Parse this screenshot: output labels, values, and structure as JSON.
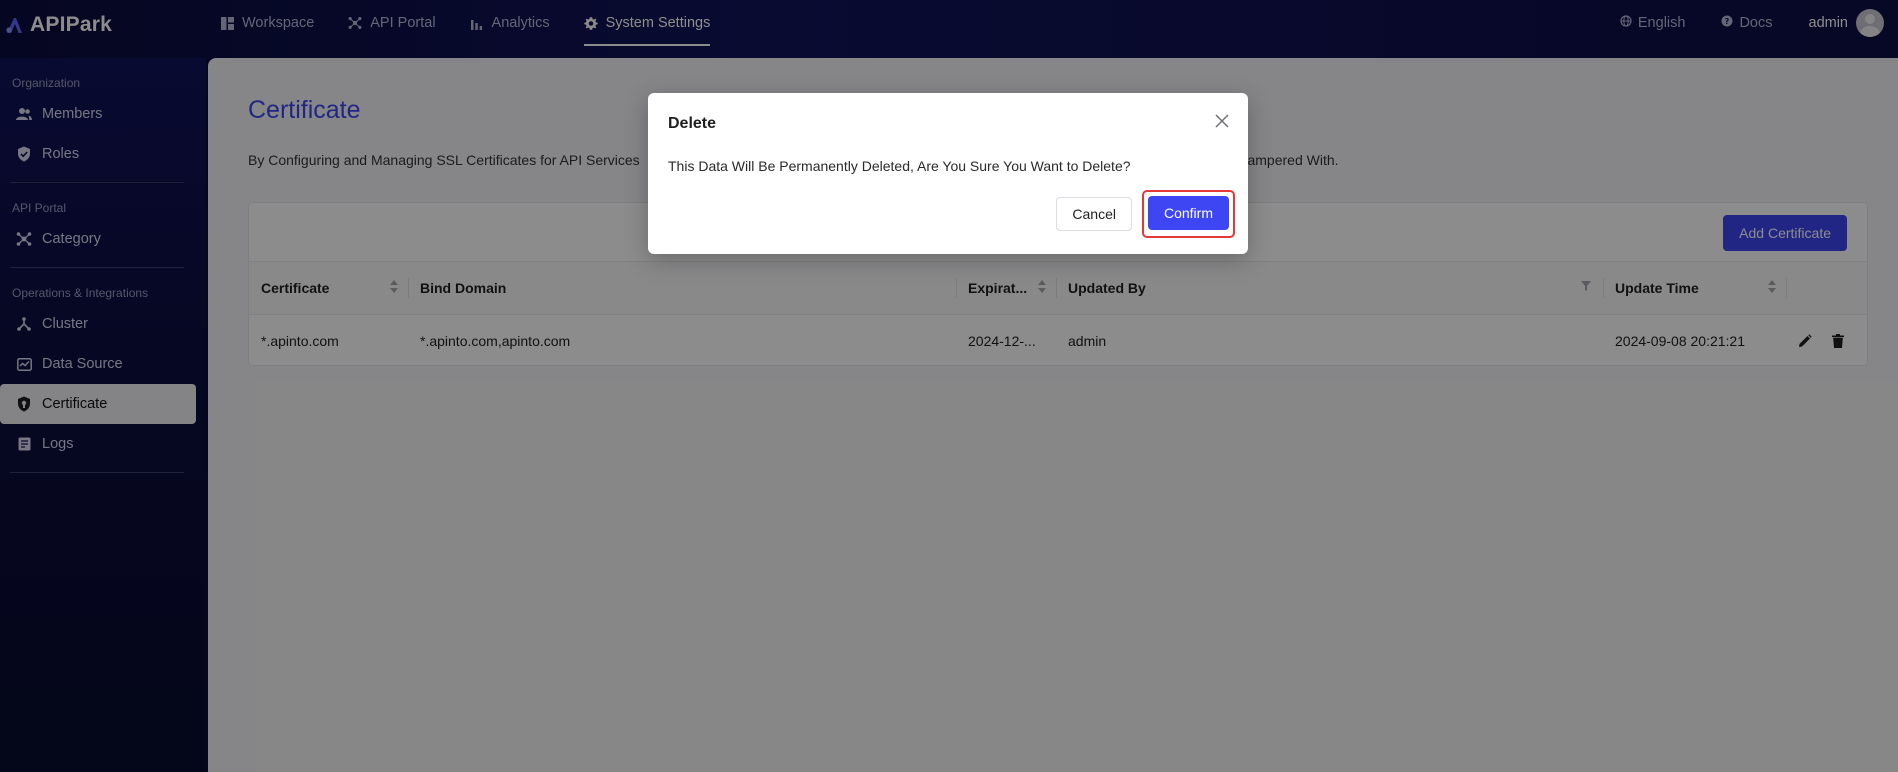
{
  "brand": {
    "name": "APIPark"
  },
  "nav": {
    "items": [
      {
        "label": "Workspace",
        "icon": "dashboard-icon"
      },
      {
        "label": "API Portal",
        "icon": "hub-icon"
      },
      {
        "label": "Analytics",
        "icon": "bar-chart-icon"
      },
      {
        "label": "System Settings",
        "icon": "gear-icon",
        "active": true
      }
    ],
    "language": "English",
    "docs": "Docs",
    "user": "admin"
  },
  "sidebar": {
    "groups": [
      {
        "title": "Organization",
        "items": [
          {
            "label": "Members",
            "icon": "people-icon"
          },
          {
            "label": "Roles",
            "icon": "shield-icon"
          }
        ]
      },
      {
        "title": "API Portal",
        "items": [
          {
            "label": "Category",
            "icon": "hub-icon"
          }
        ]
      },
      {
        "title": "Operations & Integrations",
        "items": [
          {
            "label": "Cluster",
            "icon": "cluster-icon"
          },
          {
            "label": "Data Source",
            "icon": "data-source-icon"
          },
          {
            "label": "Certificate",
            "icon": "certificate-shield-icon",
            "active": true
          },
          {
            "label": "Logs",
            "icon": "logs-icon"
          }
        ]
      }
    ]
  },
  "page": {
    "title": "Certificate",
    "description_left": "By Configuring and Managing SSL Certificates for API Services",
    "description_right": "ampered With.",
    "add_button": "Add Certificate"
  },
  "table": {
    "columns": [
      "Certificate",
      "Bind Domain",
      "Expirat...",
      "Updated By",
      "Update Time"
    ],
    "rows": [
      {
        "certificate": "*.apinto.com",
        "bind_domain": "*.apinto.com,apinto.com",
        "expiration": "2024-12-...",
        "updated_by": "admin",
        "update_time": "2024-09-08 20:21:21"
      }
    ]
  },
  "modal": {
    "title": "Delete",
    "message": "This Data Will Be Permanently Deleted, Are You Sure You Want to Delete?",
    "cancel": "Cancel",
    "confirm": "Confirm"
  },
  "colors": {
    "accent": "#3d46f2",
    "highlight": "#e53935",
    "nav_bg": "#0a0c3c"
  }
}
